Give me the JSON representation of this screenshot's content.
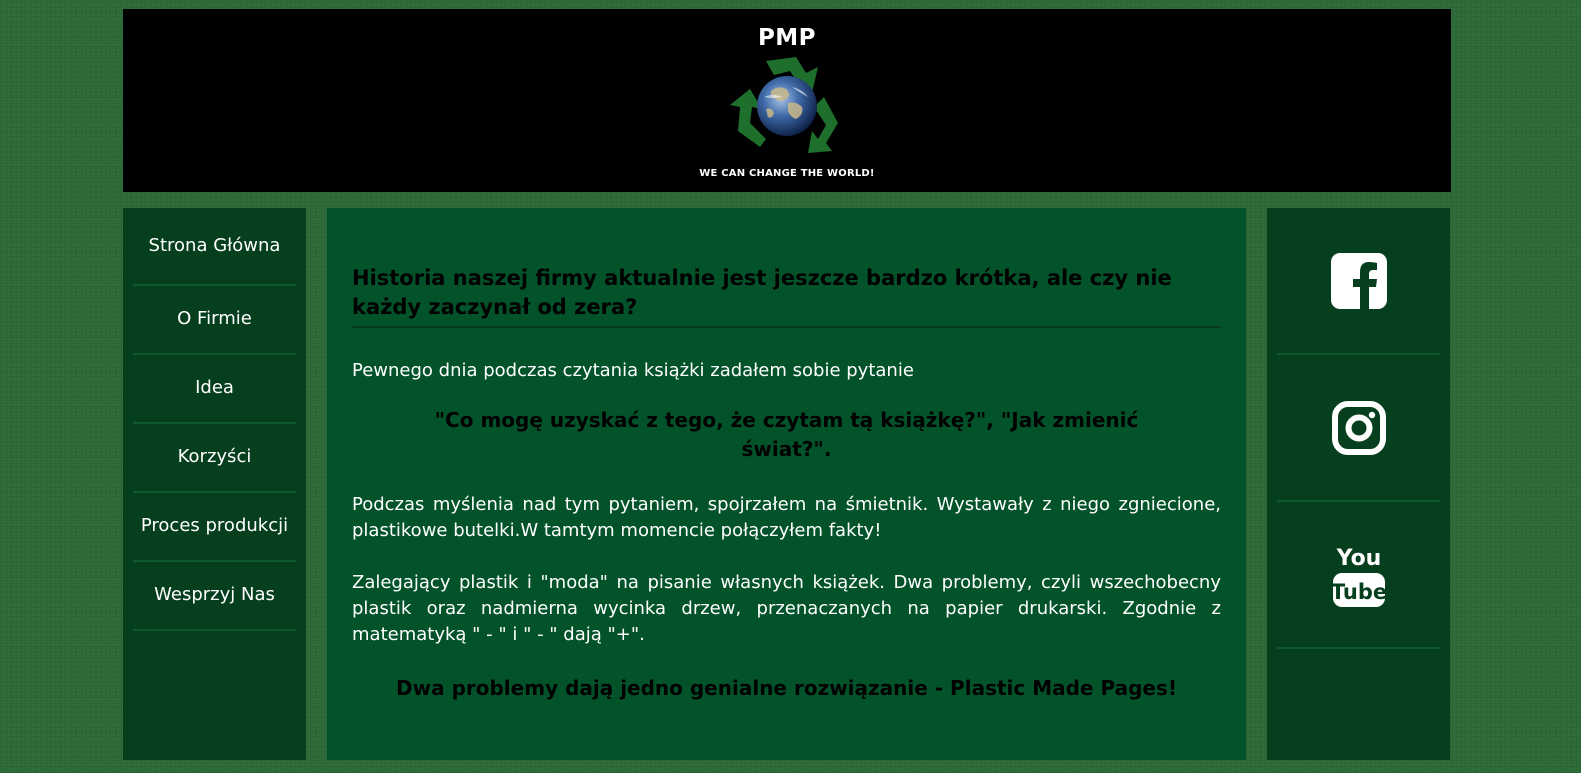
{
  "header": {
    "title": "PMP",
    "tagline": "WE CAN CHANGE THE WORLD!",
    "logo_icon": "recycle-globe-icon"
  },
  "nav": {
    "items": [
      {
        "label": "Strona Główna"
      },
      {
        "label": "O Firmie"
      },
      {
        "label": "Idea"
      },
      {
        "label": "Korzyści"
      },
      {
        "label": "Proces produkcji"
      },
      {
        "label": "Wesprzyj Nas"
      }
    ]
  },
  "main": {
    "heading": "Historia naszej firmy aktualnie jest jeszcze bardzo krótka, ale czy nie każdy zaczynał od zera?",
    "intro": "Pewnego dnia podczas czytania książki zadałem sobie pytanie",
    "quote": "\"Co mogę uzyskać z tego, że czytam tą książkę?\", \"Jak zmienić świat?\".",
    "paragraph1": "Podczas myślenia nad tym pytaniem, spojrzałem na śmietnik. Wystawały z niego zgniecione, plastikowe butelki.W tamtym momencie połączyłem fakty!",
    "paragraph2": "Zalegający plastik i \"moda\" na pisanie własnych książek. Dwa problemy, czyli wszechobecny plastik oraz nadmierna wycinka drzew, przenaczanych na papier drukarski. Zgodnie z matematyką \" - \" i \" - \" dają \"+\".",
    "conclusion": "Dwa problemy dają jedno genialne rozwiązanie - Plastic Made Pages!"
  },
  "social": {
    "items": [
      {
        "icon": "facebook-icon"
      },
      {
        "icon": "instagram-icon"
      },
      {
        "icon": "youtube-icon"
      }
    ]
  },
  "colors": {
    "background": "#2e6b3a",
    "panel_dark": "#053f1d",
    "main_panel": "#03532a",
    "header_bg": "#000000",
    "text_light": "#ffffff",
    "text_dark": "#000000"
  }
}
